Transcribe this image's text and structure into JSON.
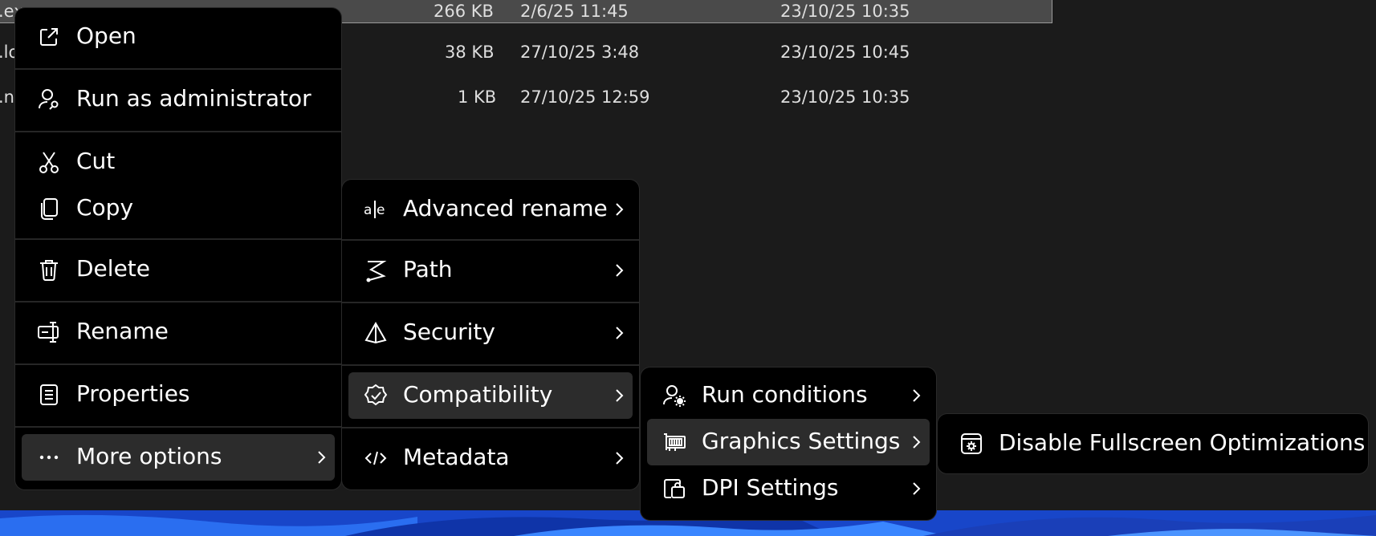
{
  "files": [
    {
      "name": ".exe",
      "size": "266 KB",
      "modified": "2/6/25 11:45",
      "created": "23/10/25 10:35",
      "selected": true
    },
    {
      "name": ".lo",
      "size": "38 KB",
      "modified": "27/10/25 3:48",
      "created": "23/10/25 10:45",
      "selected": false
    },
    {
      "name": ".ns",
      "size": "1 KB",
      "modified": "27/10/25 12:59",
      "created": "23/10/25 10:35",
      "selected": false
    }
  ],
  "menu_main": {
    "open": "Open",
    "run_as_admin": "Run as administrator",
    "cut": "Cut",
    "copy": "Copy",
    "delete": "Delete",
    "rename": "Rename",
    "properties": "Properties",
    "more_options": "More options"
  },
  "menu_more": {
    "advanced_rename": "Advanced rename",
    "path": "Path",
    "security": "Security",
    "compatibility": "Compatibility",
    "metadata": "Metadata"
  },
  "menu_compat": {
    "run_conditions": "Run conditions",
    "graphics_settings": "Graphics Settings",
    "dpi_settings": "DPI Settings"
  },
  "menu_graphics": {
    "disable_fso": "Disable Fullscreen Optimizations"
  },
  "colors": {
    "menu_bg": "#000000",
    "highlight": "#2c2c2c",
    "list_bg": "#1b1b1b",
    "selected_row": "#4a4a4a",
    "desktop": "#1f4fd0"
  }
}
